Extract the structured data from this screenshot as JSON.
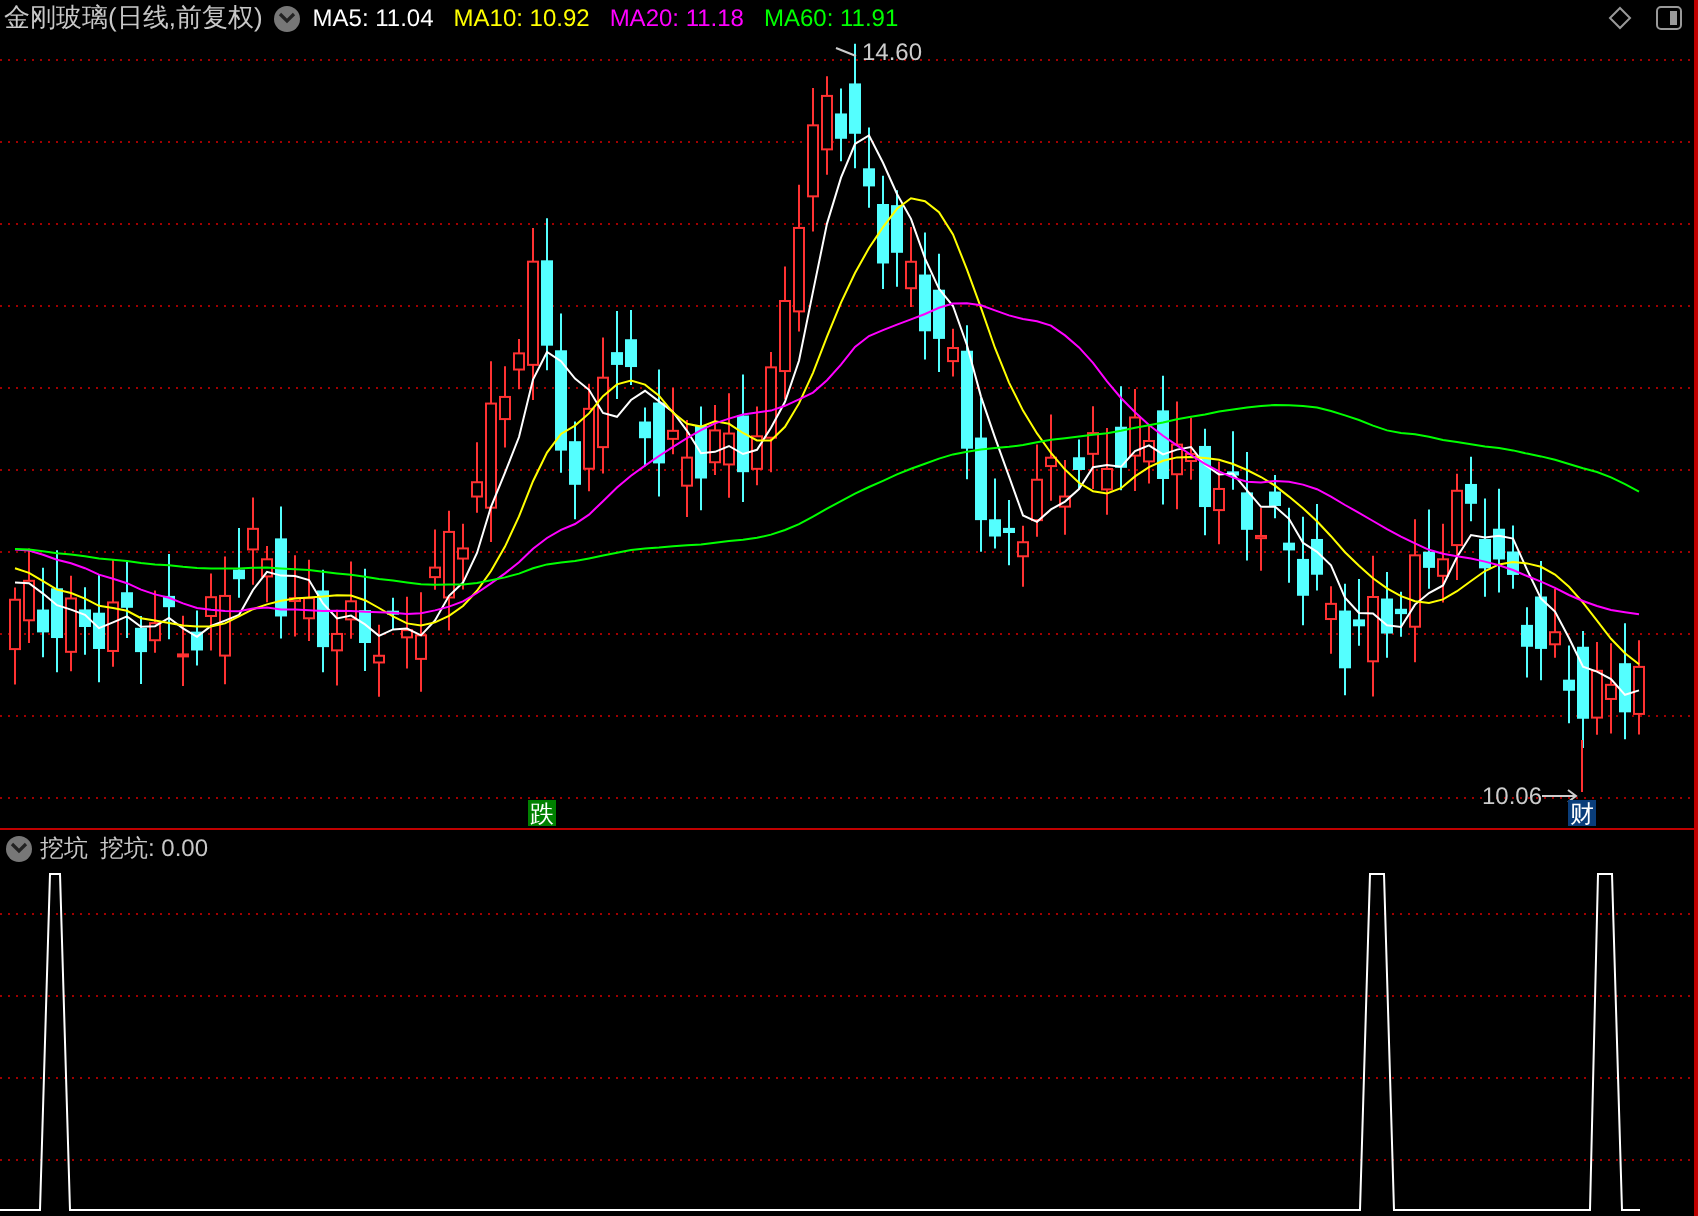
{
  "header": {
    "title": "金刚玻璃(日线,前复权)",
    "ma": [
      {
        "label": "MA5: 11.04",
        "color": "#ffffff"
      },
      {
        "label": "MA10: 10.92",
        "color": "#ffff00"
      },
      {
        "label": "MA20: 11.18",
        "color": "#ff00ff"
      },
      {
        "label": "MA60: 11.91",
        "color": "#00ff00"
      }
    ]
  },
  "price_chart": {
    "high_label": "14.60",
    "low_label": "10.06",
    "markers": [
      {
        "kind": "sell",
        "text": "跌",
        "color": "#008000"
      },
      {
        "kind": "event",
        "text": "财",
        "color": "#0a3d7a"
      }
    ]
  },
  "indicator": {
    "name": "挖坑",
    "reading": "挖坑: 0.00"
  }
}
